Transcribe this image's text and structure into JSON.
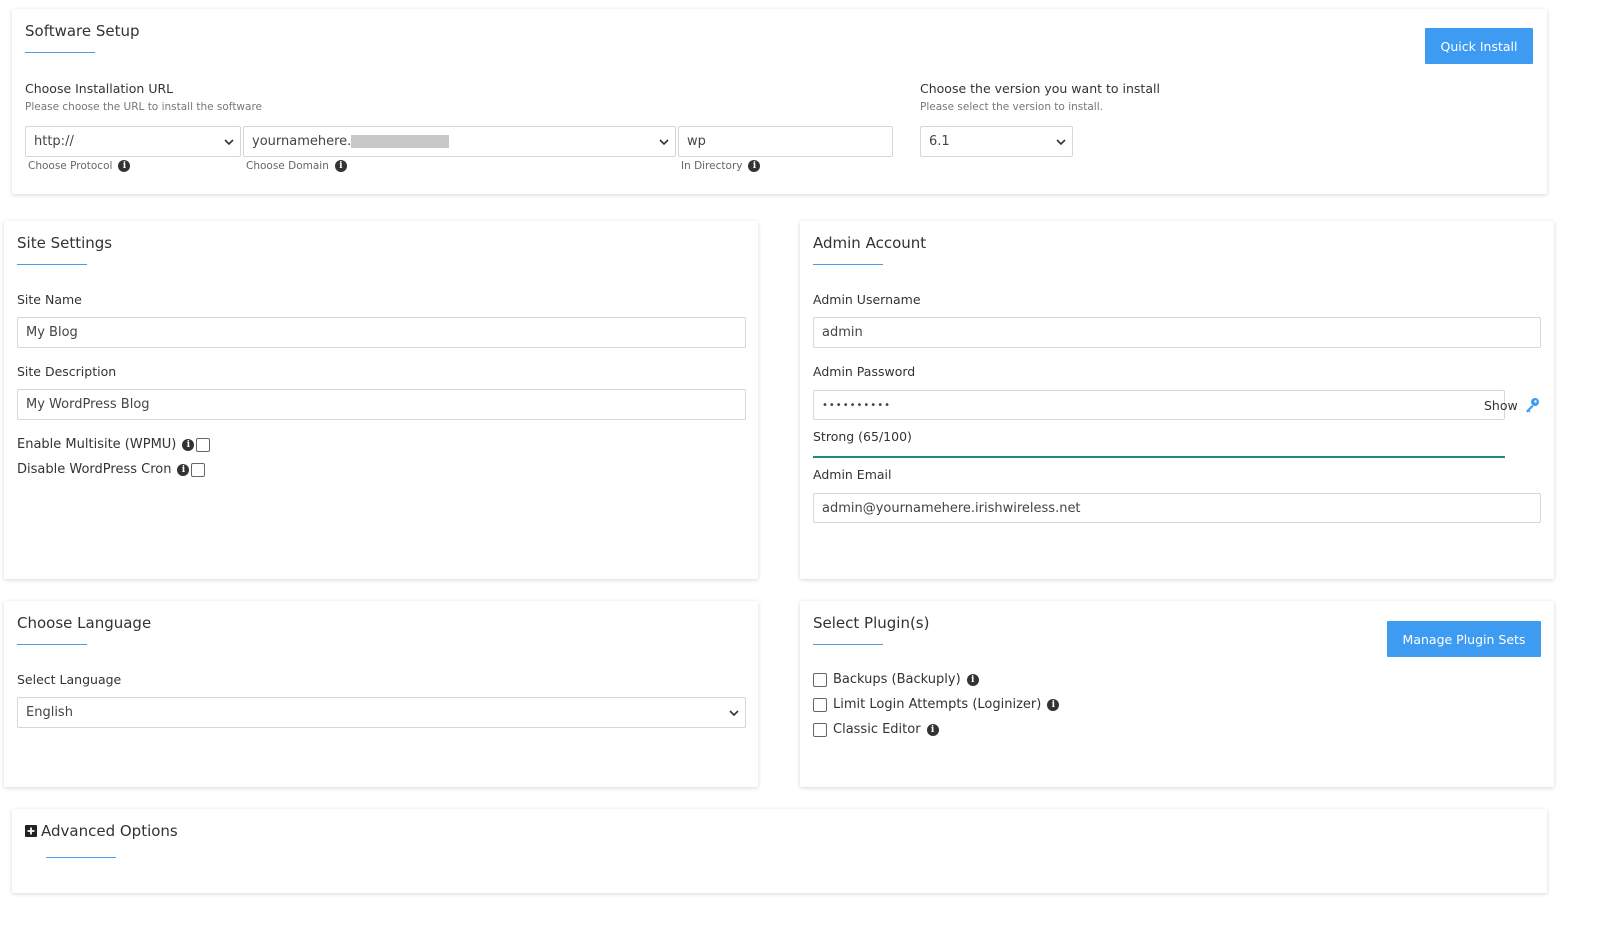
{
  "software_setup": {
    "title": "Software Setup",
    "quick_install_label": "Quick Install",
    "url_section": {
      "heading": "Choose Installation URL",
      "subheading": "Please choose the URL to install the software",
      "protocol_value": "http://",
      "protocol_hint": "Choose Protocol",
      "domain_value": "yournamehere.",
      "domain_hint": "Choose Domain",
      "directory_value": "wp",
      "directory_hint": "In Directory"
    },
    "version_section": {
      "heading": "Choose the version you want to install",
      "subheading": "Please select the version to install.",
      "version_value": "6.1"
    }
  },
  "site_settings": {
    "title": "Site Settings",
    "site_name_label": "Site Name",
    "site_name_value": "My Blog",
    "site_description_label": "Site Description",
    "site_description_value": "My WordPress Blog",
    "multisite_label": "Enable Multisite (WPMU)",
    "cron_label": "Disable WordPress Cron"
  },
  "admin_account": {
    "title": "Admin Account",
    "username_label": "Admin Username",
    "username_value": "admin",
    "password_label": "Admin Password",
    "password_value": "••••••••••",
    "show_label": "Show",
    "strength_text": "Strong (65/100)",
    "email_label": "Admin Email",
    "email_value": "admin@yournamehere.irishwireless.net"
  },
  "language": {
    "title": "Choose Language",
    "select_label": "Select Language",
    "value": "English"
  },
  "plugins": {
    "title": "Select Plugin(s)",
    "manage_label": "Manage Plugin Sets",
    "items": [
      {
        "label": "Backups (Backuply)"
      },
      {
        "label": "Limit Login Attempts (Loginizer)"
      },
      {
        "label": "Classic Editor"
      }
    ]
  },
  "advanced": {
    "title": "Advanced Options"
  },
  "colors": {
    "accent": "#3d9bf2",
    "strength_bar": "#1e8c7a"
  }
}
